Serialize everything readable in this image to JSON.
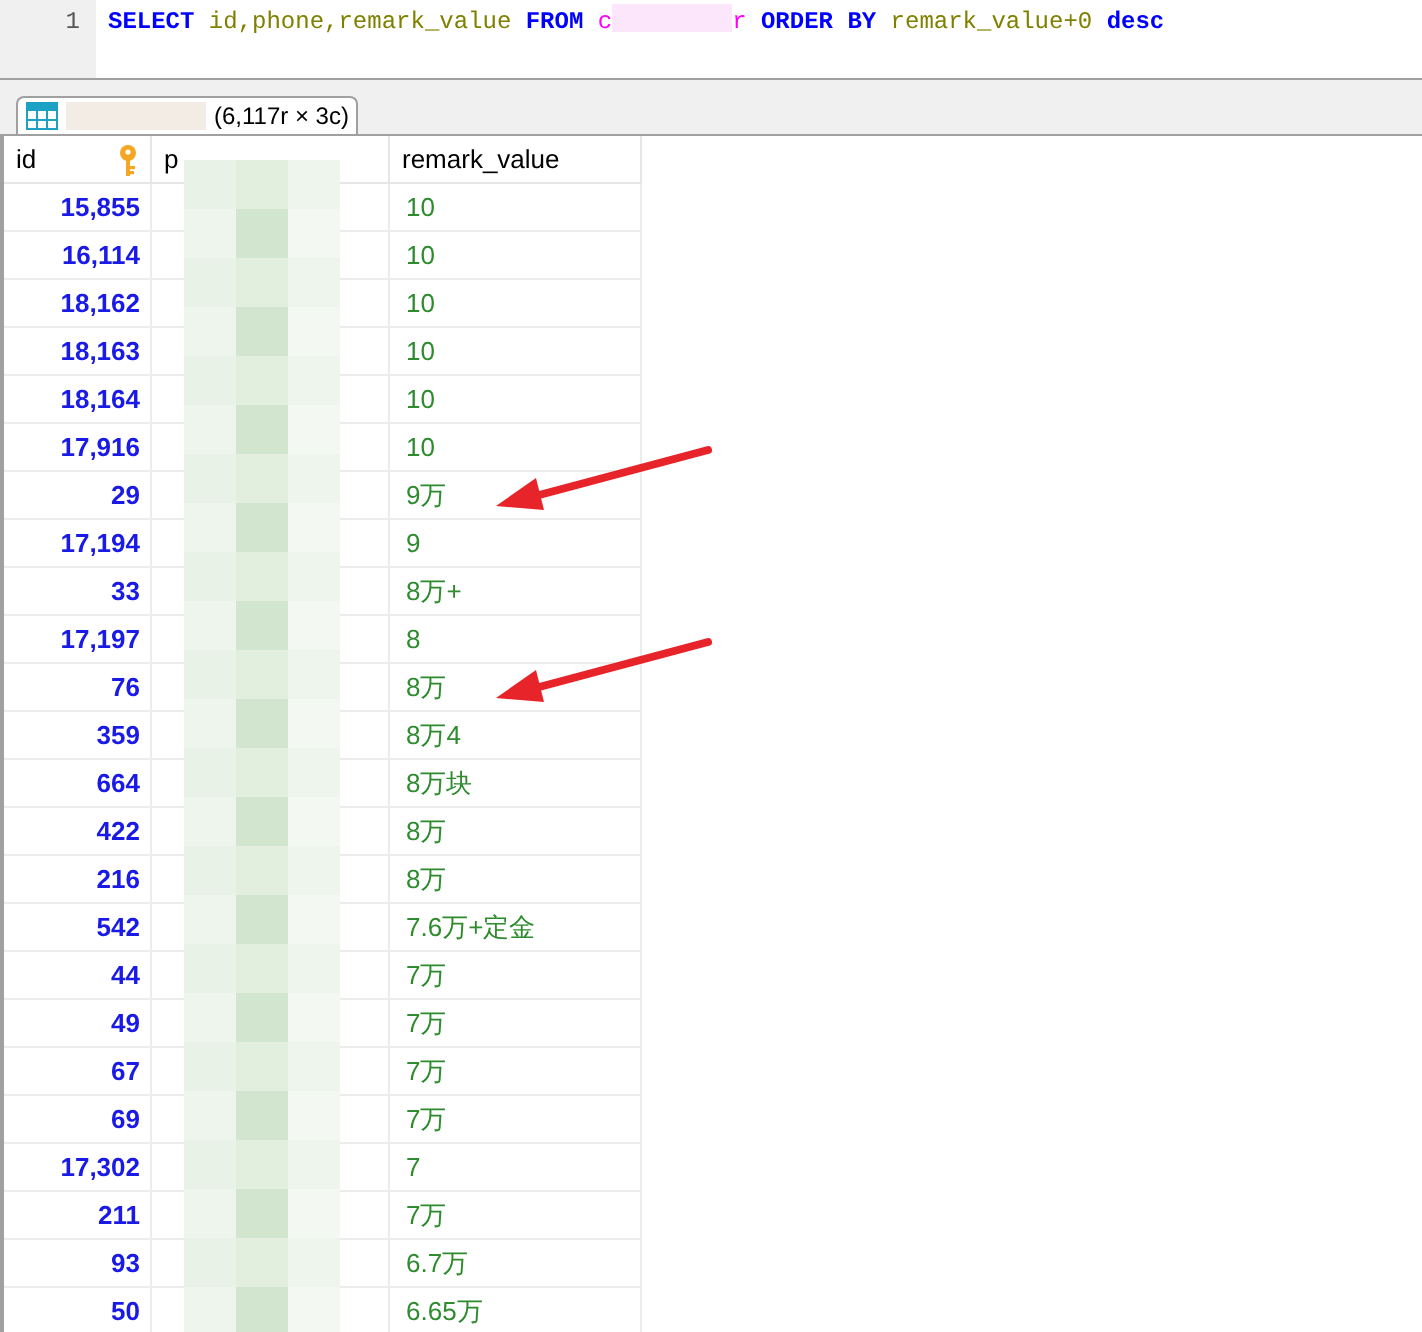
{
  "editor": {
    "line_number": "1",
    "tokens": [
      {
        "kind": "keyword",
        "text": "SELECT"
      },
      {
        "kind": "identifier",
        "text": "id,phone,remark_value"
      },
      {
        "kind": "keyword",
        "text": "FROM"
      },
      {
        "kind": "table",
        "text": "c",
        "redacted_after": true
      },
      {
        "kind": "table",
        "text": "r"
      },
      {
        "kind": "keyword",
        "text": "ORDER BY"
      },
      {
        "kind": "identifier",
        "text": "remark_value+0"
      },
      {
        "kind": "keyword",
        "text": "desc"
      }
    ]
  },
  "result_tab": {
    "summary": "(6,117r × 3c)",
    "selected": true
  },
  "table": {
    "columns": [
      {
        "label": "id",
        "key_icon": true
      },
      {
        "label": "p",
        "redacted": true
      },
      {
        "label": "remark_value"
      }
    ],
    "rows": [
      {
        "id": "15,855",
        "remark_value": "10",
        "arrow": false
      },
      {
        "id": "16,114",
        "remark_value": "10",
        "arrow": false
      },
      {
        "id": "18,162",
        "remark_value": "10",
        "arrow": false
      },
      {
        "id": "18,163",
        "remark_value": "10",
        "arrow": false
      },
      {
        "id": "18,164",
        "remark_value": "10",
        "arrow": false
      },
      {
        "id": "17,916",
        "remark_value": "10",
        "arrow": false
      },
      {
        "id": "29",
        "remark_value": "9万",
        "arrow": true
      },
      {
        "id": "17,194",
        "remark_value": "9",
        "arrow": false
      },
      {
        "id": "33",
        "remark_value": "8万+",
        "arrow": false
      },
      {
        "id": "17,197",
        "remark_value": "8",
        "arrow": false
      },
      {
        "id": "76",
        "remark_value": "8万",
        "arrow": true
      },
      {
        "id": "359",
        "remark_value": "8万4",
        "arrow": false
      },
      {
        "id": "664",
        "remark_value": "8万块",
        "arrow": false
      },
      {
        "id": "422",
        "remark_value": "8万",
        "arrow": false
      },
      {
        "id": "216",
        "remark_value": "8万",
        "arrow": false
      },
      {
        "id": "542",
        "remark_value": "7.6万+定金",
        "arrow": false
      },
      {
        "id": "44",
        "remark_value": "7万",
        "arrow": false
      },
      {
        "id": "49",
        "remark_value": "7万",
        "arrow": false
      },
      {
        "id": "67",
        "remark_value": "7万",
        "arrow": false
      },
      {
        "id": "69",
        "remark_value": "7万",
        "arrow": false
      },
      {
        "id": "17,302",
        "remark_value": "7",
        "arrow": false
      },
      {
        "id": "211",
        "remark_value": "7万",
        "arrow": false
      },
      {
        "id": "93",
        "remark_value": "6.7万",
        "arrow": false
      },
      {
        "id": "50",
        "remark_value": "6.65万",
        "arrow": false
      }
    ]
  }
}
